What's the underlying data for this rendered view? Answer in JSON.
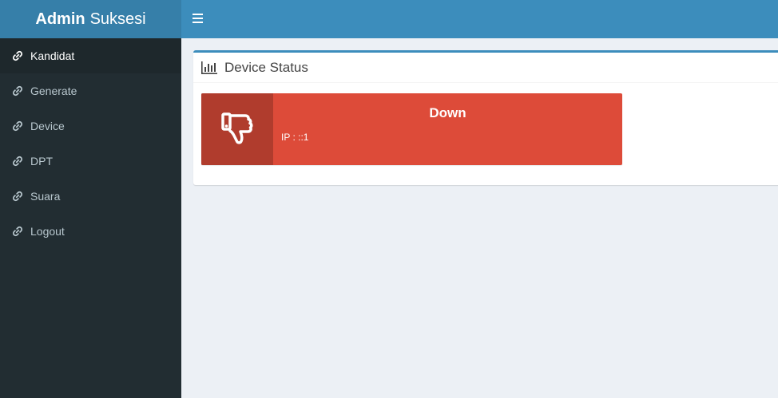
{
  "brand": {
    "bold": "Admin",
    "rest": "Suksesi"
  },
  "sidebar": {
    "items": [
      {
        "label": "Kandidat",
        "icon": "link-icon"
      },
      {
        "label": "Generate",
        "icon": "link-icon"
      },
      {
        "label": "Device",
        "icon": "link-icon"
      },
      {
        "label": "DPT",
        "icon": "link-icon"
      },
      {
        "label": "Suara",
        "icon": "link-icon"
      },
      {
        "label": "Logout",
        "icon": "link-icon"
      }
    ]
  },
  "panel": {
    "title": "Device Status",
    "status": "Down",
    "ip": "IP : ::1"
  },
  "colors": {
    "header": "#3c8dbc",
    "logo": "#367fa9",
    "sidebar": "#222d32",
    "danger": "#dd4b39"
  }
}
